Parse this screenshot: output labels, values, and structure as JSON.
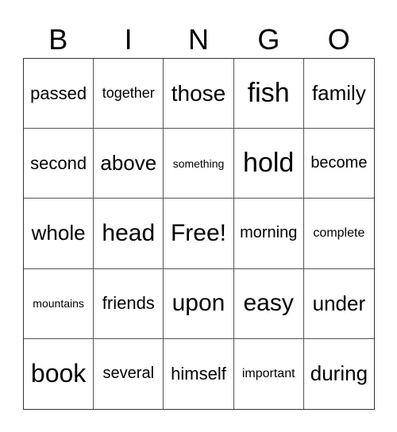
{
  "header": [
    "B",
    "I",
    "N",
    "G",
    "O"
  ],
  "cells": [
    [
      "passed",
      "together",
      "those",
      "fish",
      "family"
    ],
    [
      "second",
      "above",
      "something",
      "hold",
      "become"
    ],
    [
      "whole",
      "head",
      "Free!",
      "morning",
      "complete"
    ],
    [
      "mountains",
      "friends",
      "upon",
      "easy",
      "under"
    ],
    [
      "book",
      "several",
      "himself",
      "important",
      "during"
    ]
  ]
}
